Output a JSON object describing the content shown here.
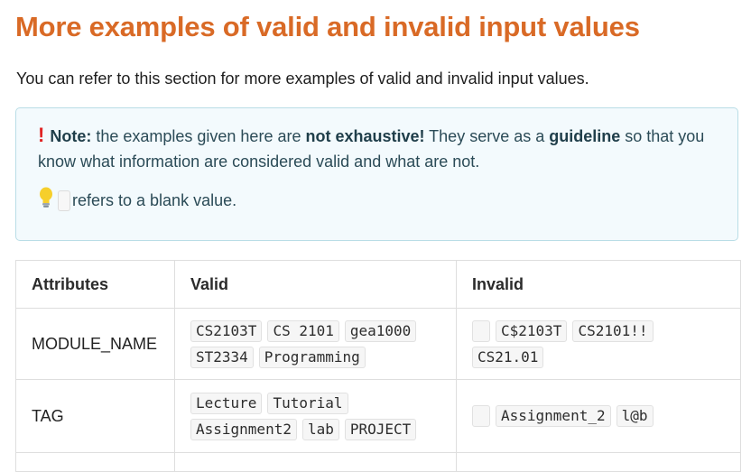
{
  "heading": "More examples of valid and invalid input values",
  "intro": "You can refer to this section for more examples of valid and invalid input values.",
  "note": {
    "label": "Note:",
    "text_1": " the examples given here are ",
    "bold_1": "not exhaustive!",
    "text_2": " They serve as a ",
    "bold_2": "guideline",
    "text_3": " so that you know what information are considered valid and what are not.",
    "tip_text": "refers to a blank value.",
    "icons": {
      "warning": "exclamation-icon",
      "tip": "lightbulb-icon"
    },
    "colors": {
      "accent": "#e02323",
      "background": "#f3fafd",
      "border": "#b9dde6"
    }
  },
  "table": {
    "headers": [
      "Attributes",
      "Valid",
      "Invalid"
    ],
    "rows": [
      {
        "attribute": "MODULE_NAME",
        "valid": [
          "CS2103T",
          "CS 2101",
          "gea1000",
          "ST2334",
          "Programming"
        ],
        "invalid": [
          "",
          "C$2103T",
          "CS2101!!",
          "CS21.01"
        ]
      },
      {
        "attribute": "TAG",
        "valid": [
          "Lecture",
          "Tutorial",
          "Assignment2",
          "lab",
          "PROJECT"
        ],
        "invalid": [
          "",
          "Assignment_2",
          "l@b"
        ]
      }
    ]
  },
  "colors": {
    "heading": "#d96a26"
  }
}
